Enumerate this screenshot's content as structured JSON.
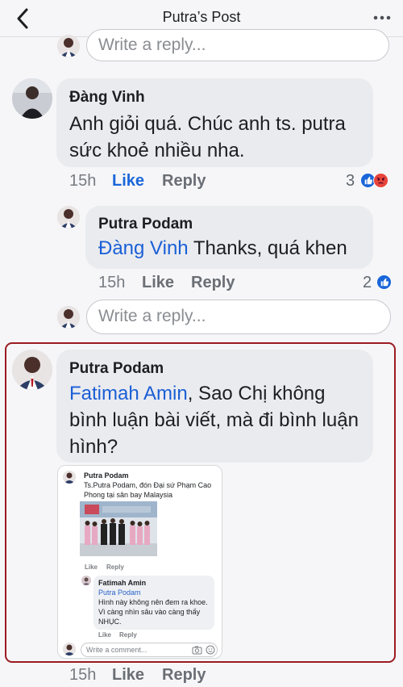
{
  "header": {
    "title": "Putra’s Post"
  },
  "top_reply_input": {
    "placeholder": "Write a reply..."
  },
  "comment1": {
    "author": "Đàng Vinh",
    "text": "Anh giỏi quá. Chúc anh ts. putra sức khoẻ nhiều nha.",
    "time": "15h",
    "like_label": "Like",
    "reply_label": "Reply",
    "reaction_count": "3"
  },
  "reply1": {
    "author": "Putra Podam",
    "mention": "Đàng Vinh",
    "text": " Thanks, quá khen",
    "time": "15h",
    "like_label": "Like",
    "reply_label": "Reply",
    "reaction_count": "2"
  },
  "reply_input": {
    "placeholder": "Write a reply..."
  },
  "comment2": {
    "author": "Putra Podam",
    "mention": "Fatimah Amin",
    "text": ", Sao Chị không bình luận bài viết, mà đi bình luận hình?",
    "time": "15h",
    "like_label": "Like",
    "reply_label": "Reply"
  },
  "embedded": {
    "comment_author": "Putra Podam",
    "comment_text": "Ts.Putra Podam, đón Đại sứ Phạm Cao Phong tại sân bay Malaysia",
    "like_label": "Like",
    "reply_label": "Reply",
    "reply_author": "Fatimah Amin",
    "reply_mention": "Putra Podam",
    "reply_text": "Hình này không nên đem ra khoe. Vì càng nhìn sâu vào càng thấy NHỤC.",
    "reply_like_label": "Like",
    "reply_reply_label": "Reply",
    "input_placeholder": "Write a comment..."
  },
  "colors": {
    "accent": "#1a66d9",
    "highlight_border": "#9b1b22",
    "bubble": "#eaebef",
    "angry": "#e8453c"
  }
}
